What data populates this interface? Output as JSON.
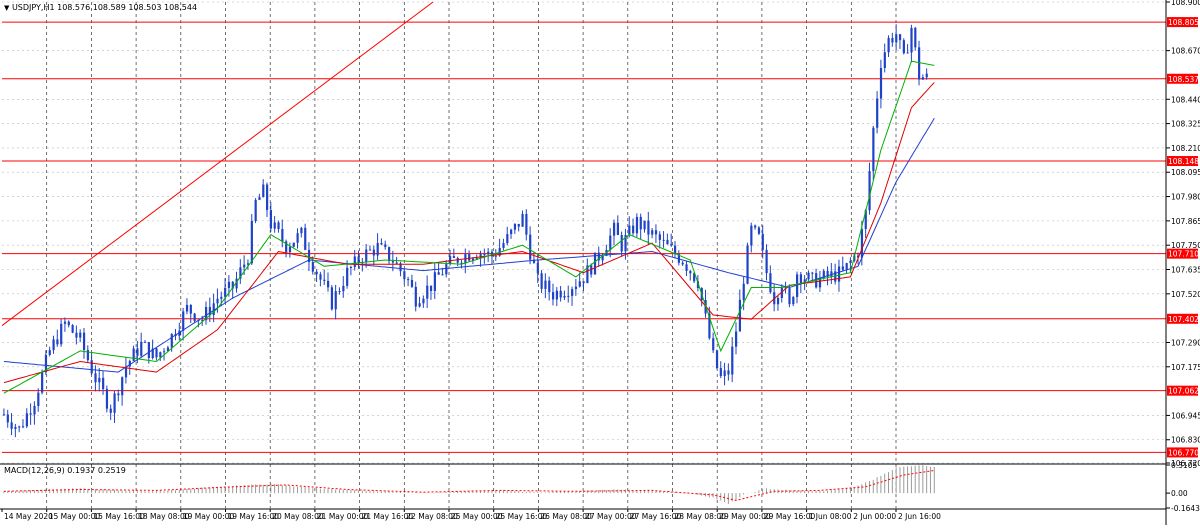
{
  "window": {
    "header_text": "USDJPY,H1  108.576 108.589 108.503 108.544",
    "collapse_icon": "triangle-down-icon"
  },
  "macd": {
    "label": "MACD(12,26,9) 0.1937 0.2519"
  },
  "colors": {
    "candle": "#1f43c8",
    "ma_fast": "#00b000",
    "ma_mid": "#e00000",
    "ma_slow": "#1f3fd0",
    "hline": "#ff0000",
    "label_bg": "#ff0000",
    "grid": "#b8b8b8",
    "vgrid": "#333333"
  },
  "chart_data": [
    {
      "type": "candlestick",
      "symbol": "USDJPY",
      "timeframe": "H1",
      "ylim": [
        106.72,
        108.9
      ],
      "y_ticks": [
        "108.900",
        "108.670",
        "108.440",
        "108.325",
        "108.210",
        "108.095",
        "107.980",
        "107.865",
        "107.750",
        "107.635",
        "107.520",
        "107.290",
        "107.175",
        "106.945",
        "106.830",
        "106.720"
      ],
      "x_ticks": [
        "14 May 2020",
        "15 May 00:00",
        "15 May 16:00",
        "18 May 08:00",
        "19 May 00:00",
        "19 May 16:00",
        "20 May 08:00",
        "21 May 00:00",
        "21 May 16:00",
        "22 May 08:00",
        "25 May 00:00",
        "25 May 16:00",
        "26 May 08:00",
        "27 May 00:00",
        "27 May 16:00",
        "28 May 08:00",
        "29 May 00:00",
        "29 May 16:00",
        "1 Jun 08:00",
        "2 Jun 00:00",
        "2 Jun 16:00"
      ],
      "horizontal_levels": [
        "108.805",
        "108.537",
        "108.148",
        "107.710",
        "107.402",
        "107.062",
        "106.770"
      ],
      "close_path": [
        [
          0,
          106.95
        ],
        [
          4,
          106.88
        ],
        [
          8,
          107.02
        ],
        [
          12,
          107.25
        ],
        [
          16,
          107.38
        ],
        [
          20,
          107.3
        ],
        [
          24,
          107.12
        ],
        [
          28,
          106.98
        ],
        [
          32,
          107.18
        ],
        [
          36,
          107.28
        ],
        [
          40,
          107.22
        ],
        [
          44,
          107.32
        ],
        [
          48,
          107.45
        ],
        [
          52,
          107.4
        ],
        [
          56,
          107.5
        ],
        [
          60,
          107.55
        ],
        [
          64,
          107.7
        ],
        [
          66,
          107.95
        ],
        [
          68,
          108.0
        ],
        [
          70,
          107.85
        ],
        [
          74,
          107.75
        ],
        [
          78,
          107.8
        ],
        [
          80,
          107.7
        ],
        [
          84,
          107.55
        ],
        [
          86,
          107.48
        ],
        [
          90,
          107.62
        ],
        [
          94,
          107.7
        ],
        [
          98,
          107.74
        ],
        [
          102,
          107.68
        ],
        [
          106,
          107.58
        ],
        [
          108,
          107.5
        ],
        [
          112,
          107.56
        ],
        [
          116,
          107.65
        ],
        [
          120,
          107.7
        ],
        [
          124,
          107.72
        ],
        [
          128,
          107.7
        ],
        [
          132,
          107.78
        ],
        [
          136,
          107.88
        ],
        [
          138,
          107.72
        ],
        [
          140,
          107.58
        ],
        [
          144,
          107.52
        ],
        [
          148,
          107.55
        ],
        [
          152,
          107.6
        ],
        [
          156,
          107.7
        ],
        [
          160,
          107.82
        ],
        [
          162,
          107.75
        ],
        [
          166,
          107.86
        ],
        [
          170,
          107.8
        ],
        [
          174,
          107.74
        ],
        [
          178,
          107.68
        ],
        [
          182,
          107.58
        ],
        [
          184,
          107.4
        ],
        [
          186,
          107.22
        ],
        [
          188,
          107.12
        ],
        [
          190,
          107.15
        ],
        [
          192,
          107.35
        ],
        [
          194,
          107.6
        ],
        [
          196,
          107.82
        ],
        [
          198,
          107.78
        ],
        [
          200,
          107.62
        ],
        [
          202,
          107.5
        ],
        [
          204,
          107.58
        ],
        [
          206,
          107.45
        ],
        [
          208,
          107.62
        ],
        [
          212,
          107.58
        ],
        [
          216,
          107.6
        ],
        [
          220,
          107.62
        ],
        [
          224,
          107.72
        ],
        [
          226,
          107.9
        ],
        [
          228,
          108.3
        ],
        [
          230,
          108.62
        ],
        [
          232,
          108.72
        ],
        [
          234,
          108.75
        ],
        [
          236,
          108.62
        ],
        [
          238,
          108.78
        ],
        [
          240,
          108.55
        ],
        [
          242,
          108.54
        ]
      ],
      "ma_fast": [
        [
          0,
          107.05
        ],
        [
          20,
          107.25
        ],
        [
          40,
          107.2
        ],
        [
          56,
          107.45
        ],
        [
          70,
          107.8
        ],
        [
          84,
          107.65
        ],
        [
          100,
          107.68
        ],
        [
          120,
          107.66
        ],
        [
          136,
          107.75
        ],
        [
          150,
          107.6
        ],
        [
          164,
          107.8
        ],
        [
          180,
          107.68
        ],
        [
          188,
          107.25
        ],
        [
          196,
          107.55
        ],
        [
          204,
          107.55
        ],
        [
          222,
          107.62
        ],
        [
          230,
          108.2
        ],
        [
          238,
          108.62
        ],
        [
          244,
          108.6
        ]
      ],
      "ma_mid": [
        [
          0,
          107.1
        ],
        [
          20,
          107.2
        ],
        [
          40,
          107.15
        ],
        [
          56,
          107.35
        ],
        [
          72,
          107.72
        ],
        [
          90,
          107.66
        ],
        [
          110,
          107.66
        ],
        [
          136,
          107.72
        ],
        [
          152,
          107.62
        ],
        [
          170,
          107.76
        ],
        [
          186,
          107.42
        ],
        [
          196,
          107.4
        ],
        [
          206,
          107.56
        ],
        [
          222,
          107.6
        ],
        [
          230,
          107.95
        ],
        [
          238,
          108.4
        ],
        [
          244,
          108.52
        ]
      ],
      "ma_slow": [
        [
          0,
          107.2
        ],
        [
          30,
          107.15
        ],
        [
          60,
          107.5
        ],
        [
          80,
          107.68
        ],
        [
          110,
          107.63
        ],
        [
          140,
          107.68
        ],
        [
          170,
          107.72
        ],
        [
          190,
          107.62
        ],
        [
          206,
          107.55
        ],
        [
          224,
          107.65
        ],
        [
          234,
          108.05
        ],
        [
          244,
          108.35
        ]
      ]
    },
    {
      "type": "histogram",
      "name": "MACD(12,26,9)",
      "ylim": [
        -0.1643,
        0.3105
      ],
      "y_ticks": [
        "0.3105",
        "0.00",
        "-0.1643"
      ],
      "histogram": [
        [
          0,
          0.02
        ],
        [
          10,
          0.04
        ],
        [
          20,
          0.05
        ],
        [
          30,
          0.03
        ],
        [
          40,
          0.02
        ],
        [
          50,
          0.05
        ],
        [
          60,
          0.08
        ],
        [
          70,
          0.1
        ],
        [
          80,
          0.06
        ],
        [
          90,
          0.03
        ],
        [
          100,
          0.02
        ],
        [
          110,
          0.0
        ],
        [
          120,
          0.02
        ],
        [
          130,
          0.03
        ],
        [
          140,
          0.01
        ],
        [
          150,
          0.02
        ],
        [
          160,
          0.04
        ],
        [
          170,
          0.03
        ],
        [
          180,
          0.0
        ],
        [
          186,
          -0.05
        ],
        [
          190,
          -0.12
        ],
        [
          194,
          -0.02
        ],
        [
          200,
          0.05
        ],
        [
          206,
          0.03
        ],
        [
          214,
          0.02
        ],
        [
          222,
          0.05
        ],
        [
          228,
          0.15
        ],
        [
          234,
          0.28
        ],
        [
          240,
          0.31
        ],
        [
          244,
          0.29
        ]
      ],
      "signal": [
        [
          0,
          0.02
        ],
        [
          20,
          0.04
        ],
        [
          40,
          0.03
        ],
        [
          60,
          0.07
        ],
        [
          74,
          0.09
        ],
        [
          90,
          0.04
        ],
        [
          110,
          0.01
        ],
        [
          130,
          0.03
        ],
        [
          150,
          0.02
        ],
        [
          170,
          0.03
        ],
        [
          186,
          -0.02
        ],
        [
          192,
          -0.08
        ],
        [
          202,
          0.02
        ],
        [
          214,
          0.03
        ],
        [
          226,
          0.07
        ],
        [
          236,
          0.2
        ],
        [
          244,
          0.25
        ]
      ]
    }
  ]
}
